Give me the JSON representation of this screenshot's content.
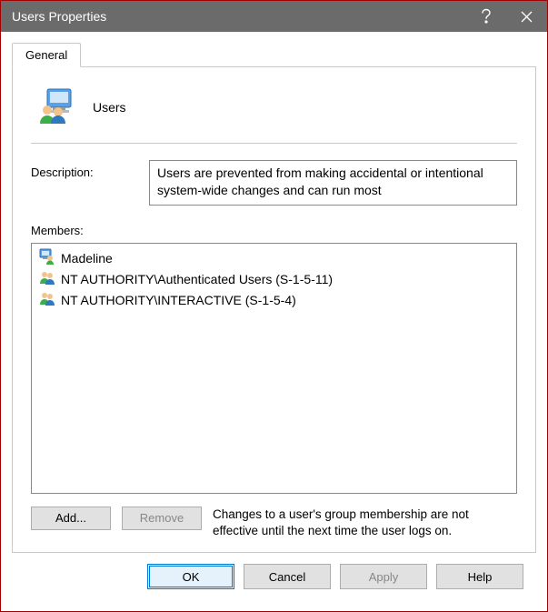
{
  "window": {
    "title": "Users Properties"
  },
  "tabs": [
    {
      "label": "General"
    }
  ],
  "general": {
    "group_name": "Users",
    "description_label": "Description:",
    "description_value": "Users are prevented from making accidental or intentional system-wide changes and can run most",
    "members_label": "Members:",
    "members": [
      {
        "icon": "user-icon",
        "name": "Madeline"
      },
      {
        "icon": "group-icon",
        "name": "NT AUTHORITY\\Authenticated Users (S-1-5-11)"
      },
      {
        "icon": "group-icon",
        "name": "NT AUTHORITY\\INTERACTIVE (S-1-5-4)"
      }
    ],
    "add_label": "Add...",
    "remove_label": "Remove",
    "note": "Changes to a user's group membership are not effective until the next time the user logs on."
  },
  "footer": {
    "ok": "OK",
    "cancel": "Cancel",
    "apply": "Apply",
    "help": "Help"
  }
}
